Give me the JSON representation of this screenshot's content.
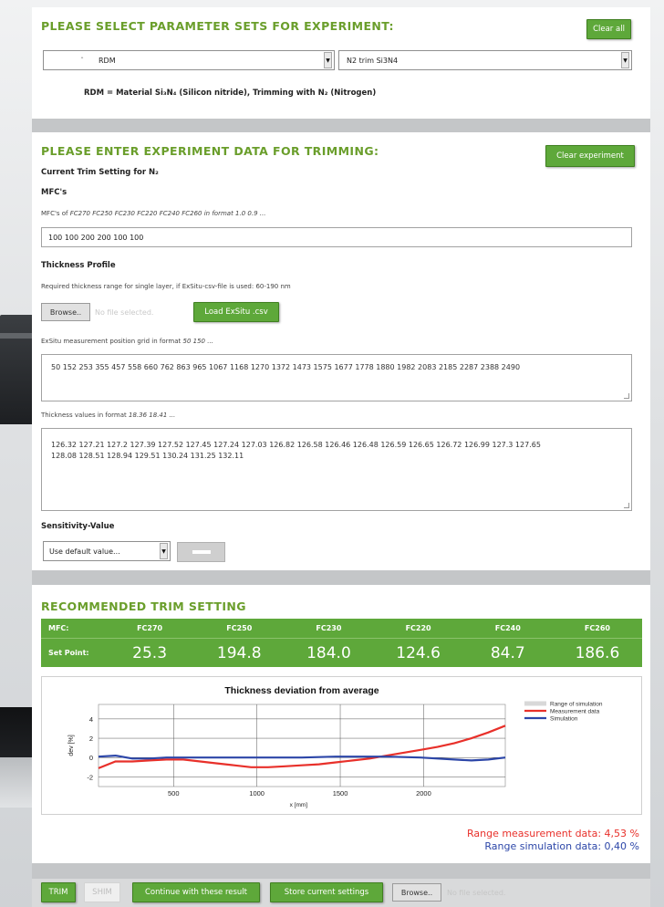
{
  "section1": {
    "title": "PLEASE SELECT PARAMETER SETS FOR EXPERIMENT:",
    "clear_all": "Clear all",
    "select_left": "RDM",
    "select_right": "N2 trim Si3N4",
    "description": "RDM = Material Si₃N₄ (Silicon nitride), Trimming with N₂ (Nitrogen)"
  },
  "section2": {
    "title": "PLEASE ENTER EXPERIMENT DATA FOR TRIMMING:",
    "clear_experiment": "Clear experiment",
    "current_trim": "Current Trim Setting for N₂",
    "mfcs_label": "MFC's",
    "mfcs_hint_prefix": "MFC's of ",
    "mfcs_hint_italic": "FC270 FC250 FC230 FC220 FC240 FC260 in format 1.0 0.9 ...",
    "mfcs_value": "100 100 200 200 100 100",
    "thickness_profile": "Thickness Profile",
    "thickness_hint": "Required thickness range for single layer, if ExSitu-csv-file is used: 60-190 nm",
    "browse": "Browse..",
    "no_file": "No file selected.",
    "load_btn": "Load ExSitu .csv",
    "grid_hint_prefix": "ExSitu measurement position grid in format ",
    "grid_hint_italic": "50 150 ...",
    "grid_value": "50 152 253 355 457 558 660 762 863 965 1067 1168 1270 1372 1473 1575 1677 1778 1880 1982 2083 2185 2287 2388 2490",
    "thick_hint_prefix": "Thickness values in format ",
    "thick_hint_italic": "18.36 18.41 ...",
    "thick_value_line1": "126.32 127.21 127.2 127.39 127.52 127.45 127.24 127.03 126.82 126.58 126.46 126.48 126.59 126.65 126.72 126.99 127.3 127.65",
    "thick_value_line2": "128.08 128.51 128.94 129.51 130.24 131.25 132.11",
    "sensitivity_label": "Sensitivity-Value",
    "sensitivity_select": "Use default value..."
  },
  "section3": {
    "title": "RECOMMENDED TRIM SETTING",
    "mfc_label": "MFC:",
    "setpoint_label": "Set Point:",
    "columns": [
      "FC270",
      "FC250",
      "FC230",
      "FC220",
      "FC240",
      "FC260"
    ],
    "setpoints": [
      "25.3",
      "194.8",
      "184.0",
      "124.6",
      "84.7",
      "186.6"
    ],
    "range_measurement": "Range measurement data: 4,53 %",
    "range_simulation": "Range simulation data: 0,40 %"
  },
  "section4": {
    "trim": "TRIM",
    "shim": "SHIM",
    "continue": "Continue with these result",
    "store": "Store current settings",
    "browse": "Browse..",
    "no_file": "No file selected."
  },
  "colors": {
    "accent_green": "#5ea83a",
    "heading_green": "#6a9e2b",
    "measurement_red": "#e8302a",
    "simulation_blue": "#2c46a8"
  },
  "chart_data": {
    "type": "line",
    "title": "Thickness deviation from average",
    "xlabel": "x [mm]",
    "ylabel": "dev [%]",
    "xlim": [
      50,
      2490
    ],
    "ylim": [
      -3,
      5.5
    ],
    "xticks": [
      500,
      1000,
      1500,
      2000
    ],
    "yticks": [
      4,
      2,
      0,
      -2
    ],
    "grid": true,
    "legend": "right",
    "series": [
      {
        "name": "Range of simulation",
        "color": "#d8d8d8",
        "x": [],
        "y": []
      },
      {
        "name": "Measurement data",
        "color": "#e8302a",
        "x": [
          50,
          152,
          253,
          355,
          457,
          558,
          660,
          762,
          863,
          965,
          1067,
          1168,
          1270,
          1372,
          1473,
          1575,
          1677,
          1778,
          1880,
          1982,
          2083,
          2185,
          2287,
          2388,
          2490
        ],
        "y": [
          -1.1,
          -0.4,
          -0.4,
          -0.3,
          -0.2,
          -0.2,
          -0.4,
          -0.6,
          -0.8,
          -1.0,
          -1.0,
          -0.9,
          -0.8,
          -0.7,
          -0.5,
          -0.3,
          -0.1,
          0.2,
          0.5,
          0.8,
          1.1,
          1.5,
          2.0,
          2.6,
          3.3
        ]
      },
      {
        "name": "Simulation",
        "color": "#2c46a8",
        "x": [
          50,
          152,
          253,
          355,
          457,
          558,
          660,
          762,
          863,
          965,
          1067,
          1168,
          1270,
          1372,
          1473,
          1575,
          1677,
          1778,
          1880,
          1982,
          2083,
          2185,
          2287,
          2388,
          2490
        ],
        "y": [
          0.1,
          0.2,
          -0.1,
          -0.1,
          0.0,
          0.0,
          0.0,
          0.0,
          0.0,
          0.0,
          0.0,
          0.0,
          0.0,
          0.05,
          0.1,
          0.1,
          0.1,
          0.1,
          0.05,
          0.0,
          -0.1,
          -0.2,
          -0.3,
          -0.2,
          0.0
        ]
      }
    ]
  }
}
